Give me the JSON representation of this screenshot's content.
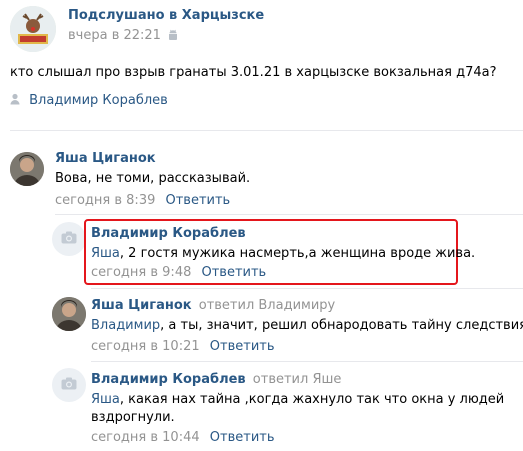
{
  "post": {
    "group_name": "Подслушано в Харцызске",
    "time": "вчера в 22:21",
    "text": "кто слышал про взрыв гранаты 3.01.21 в харцызске вокзальная д74а?",
    "signer": "Владимир Кораблев",
    "icons": [
      "group-avatar-icon",
      "android-icon",
      "user-icon"
    ]
  },
  "comments": [
    {
      "author": "Яша Циганок",
      "text": "Вова, не томи, рассказывай.",
      "time": "сегодня в 8:39",
      "reply_label": "Ответить",
      "avatar": "photo"
    },
    {
      "author": "Владимир Кораблев",
      "mention": "Яша",
      "text": ", 2 гостя мужика насмерть,а женщина вроде жива.",
      "time": "сегодня в 9:48",
      "reply_label": "Ответить",
      "avatar": "camera-icon",
      "highlighted": true,
      "highlight_color": "#e4161c"
    },
    {
      "author": "Яша Циганок",
      "replied_to": "ответил Владимиру",
      "mention": "Владимир",
      "text": ", а ты, значит, решил обнародовать тайну следствия?",
      "time": "сегодня в 10:21",
      "reply_label": "Ответить",
      "avatar": "photo"
    },
    {
      "author": "Владимир Кораблев",
      "replied_to": "ответил Яше",
      "mention": "Яша",
      "text_line1": ", какая нах тайна ,когда жахнуло так что окна у людей",
      "text_line2": "вздрогнули.",
      "time": "сегодня в 10:44",
      "reply_label": "Ответить",
      "avatar": "camera-icon"
    }
  ],
  "colors": {
    "link": "#2a5885",
    "meta": "#939393",
    "divider": "#e7e8ec",
    "highlight": "#e4161c"
  }
}
